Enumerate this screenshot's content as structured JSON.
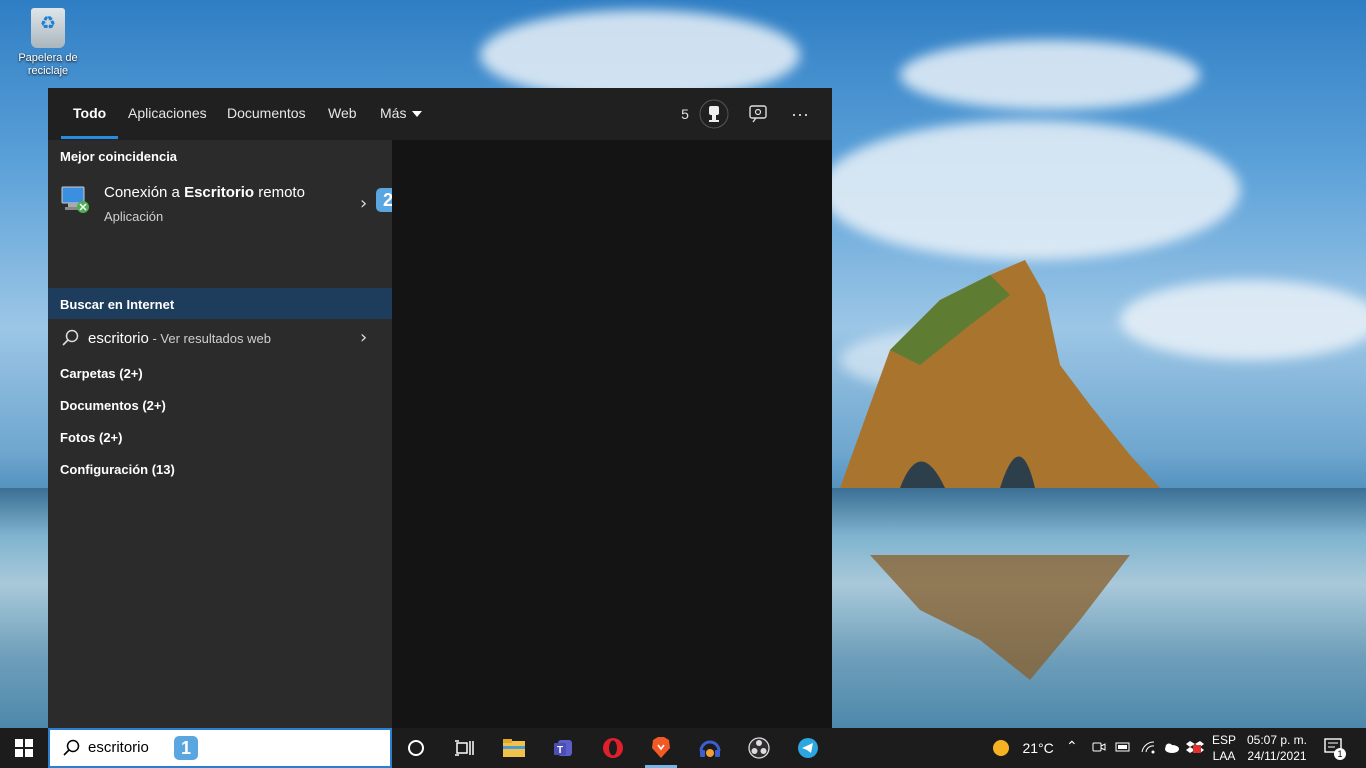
{
  "desktop": {
    "recycle_bin_label": "Papelera de reciclaje"
  },
  "search_panel": {
    "tabs": [
      "Todo",
      "Aplicaciones",
      "Documentos",
      "Web",
      "Más"
    ],
    "active_tab": "Todo",
    "rewards_points": "5",
    "best_match_title": "Mejor coincidencia",
    "best_match": {
      "name_prefix": "Conexión a ",
      "name_bold": "Escritorio",
      "name_suffix": " remoto",
      "type": "Aplicación",
      "badge": "2"
    },
    "internet_title": "Buscar en Internet",
    "web_result": {
      "query": "escritorio",
      "suffix": " - Ver resultados web"
    },
    "categories": [
      "Carpetas (2+)",
      "Documentos (2+)",
      "Fotos (2+)",
      "Configuración (13)"
    ]
  },
  "taskbar": {
    "search_value": "escritorio",
    "search_badge": "1",
    "weather_temp": "21°C",
    "language": "ESP",
    "layout": "LAA",
    "time": "05:07 p. m.",
    "date": "24/11/2021",
    "notifications": "1",
    "icons": [
      "start-icon",
      "cortana-icon",
      "task-view-icon",
      "file-explorer-icon",
      "teams-icon",
      "opera-icon",
      "brave-icon",
      "audio-app-icon",
      "obs-icon",
      "telegram-icon"
    ]
  }
}
